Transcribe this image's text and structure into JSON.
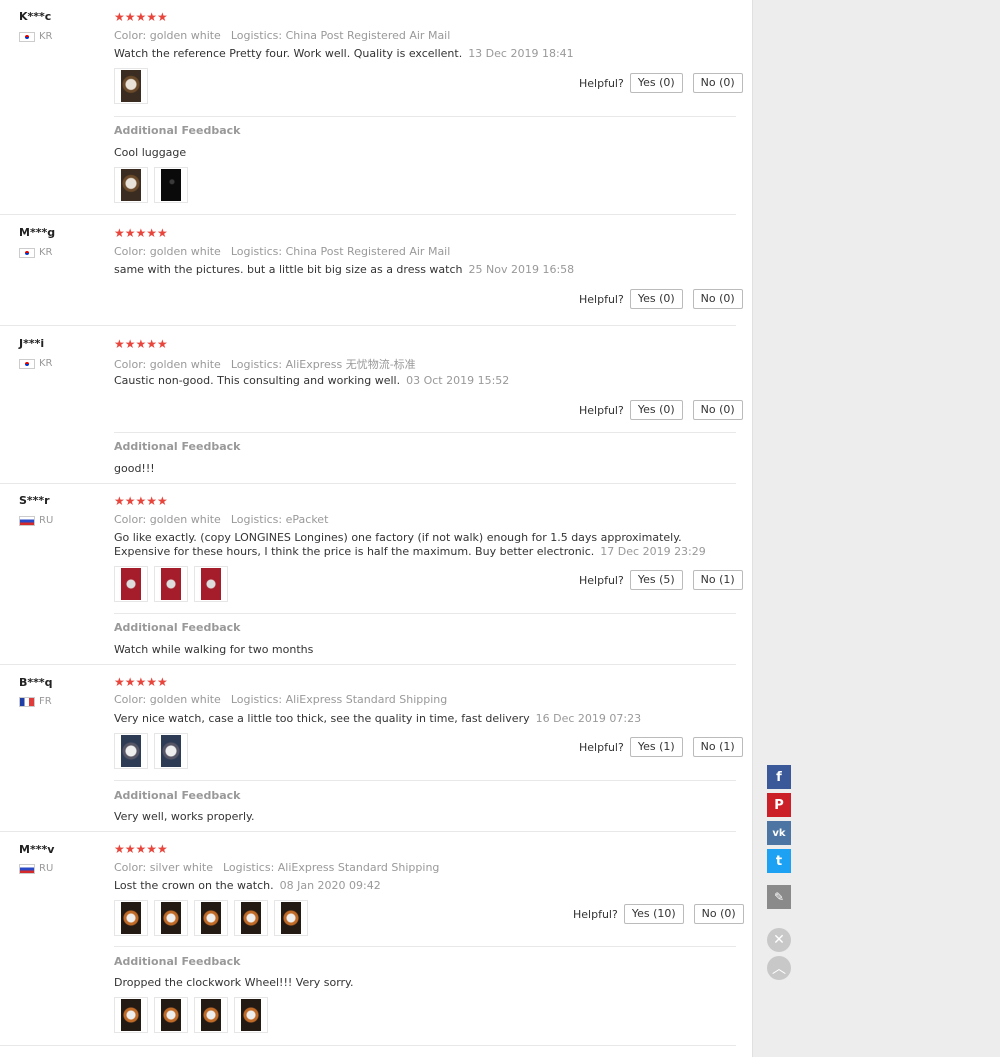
{
  "reviews": [
    {
      "user": "K***c",
      "country": "KR",
      "stars": "★★★★★",
      "color_label": "Color:",
      "color": "golden white",
      "logistics_label": "Logistics:",
      "logistics": "China Post Registered Air Mail",
      "text": "Watch the reference Pretty four. Work well. Quality is excellent.",
      "date": "13 Dec 2019 18:41",
      "helpful_label": "Helpful?",
      "yes": "Yes (0)",
      "no": "No (0)",
      "additional_label": "Additional Feedback",
      "additional_text": "Cool luggage"
    },
    {
      "user": "M***g",
      "country": "KR",
      "stars": "★★★★★",
      "color_label": "Color:",
      "color": "golden white",
      "logistics_label": "Logistics:",
      "logistics": "China Post Registered Air Mail",
      "text": "same with the pictures. but a little bit big size as a dress watch",
      "date": "25 Nov 2019 16:58",
      "helpful_label": "Helpful?",
      "yes": "Yes (0)",
      "no": "No (0)"
    },
    {
      "user": "J***i",
      "country": "KR",
      "stars": "★★★★★",
      "color_label": "Color:",
      "color": "golden white",
      "logistics_label": "Logistics:",
      "logistics": "AliExpress 无忧物流-标准",
      "text": "Caustic non-good. This consulting and working well.",
      "date": "03 Oct 2019 15:52",
      "helpful_label": "Helpful?",
      "yes": "Yes (0)",
      "no": "No (0)",
      "additional_label": "Additional Feedback",
      "additional_text": "good!!!"
    },
    {
      "user": "S***r",
      "country": "RU",
      "stars": "★★★★★",
      "color_label": "Color:",
      "color": "golden white",
      "logistics_label": "Logistics:",
      "logistics": "ePacket",
      "text_line1": "Go like exactly. (copy LONGINES Longines) one factory (if not walk) enough for 1.5 days approximately.",
      "text": "Expensive for these hours, I think the price is half the maximum. Buy better electronic.",
      "date": "17 Dec 2019 23:29",
      "helpful_label": "Helpful?",
      "yes": "Yes (5)",
      "no": "No (1)",
      "additional_label": "Additional Feedback",
      "additional_text": "Watch while walking for two months"
    },
    {
      "user": "B***q",
      "country": "FR",
      "stars": "★★★★★",
      "color_label": "Color:",
      "color": "golden white",
      "logistics_label": "Logistics:",
      "logistics": "AliExpress Standard Shipping",
      "text": "Very nice watch, case a little too thick, see the quality in time, fast delivery",
      "date": "16 Dec 2019 07:23",
      "helpful_label": "Helpful?",
      "yes": "Yes (1)",
      "no": "No (1)",
      "additional_label": "Additional Feedback",
      "additional_text": "Very well, works properly."
    },
    {
      "user": "M***v",
      "country": "RU",
      "stars": "★★★★★",
      "color_label": "Color:",
      "color": "silver white",
      "logistics_label": "Logistics:",
      "logistics": "AliExpress Standard Shipping",
      "text": "Lost the crown on the watch.",
      "date": "08 Jan 2020 09:42",
      "helpful_label": "Helpful?",
      "yes": "Yes (10)",
      "no": "No (0)",
      "additional_label": "Additional Feedback",
      "additional_text": "Dropped the clockwork Wheel!!! Very sorry."
    }
  ],
  "share": {
    "facebook_icon": "facebook-icon",
    "pinterest_icon": "pinterest-icon",
    "vk_icon": "vk-icon",
    "twitter_icon": "twitter-icon"
  },
  "colors": {
    "star": "#e8453c",
    "facebook": "#3b5998",
    "pinterest": "#cb2027",
    "vk": "#4c75a3",
    "twitter": "#1da1f2"
  }
}
